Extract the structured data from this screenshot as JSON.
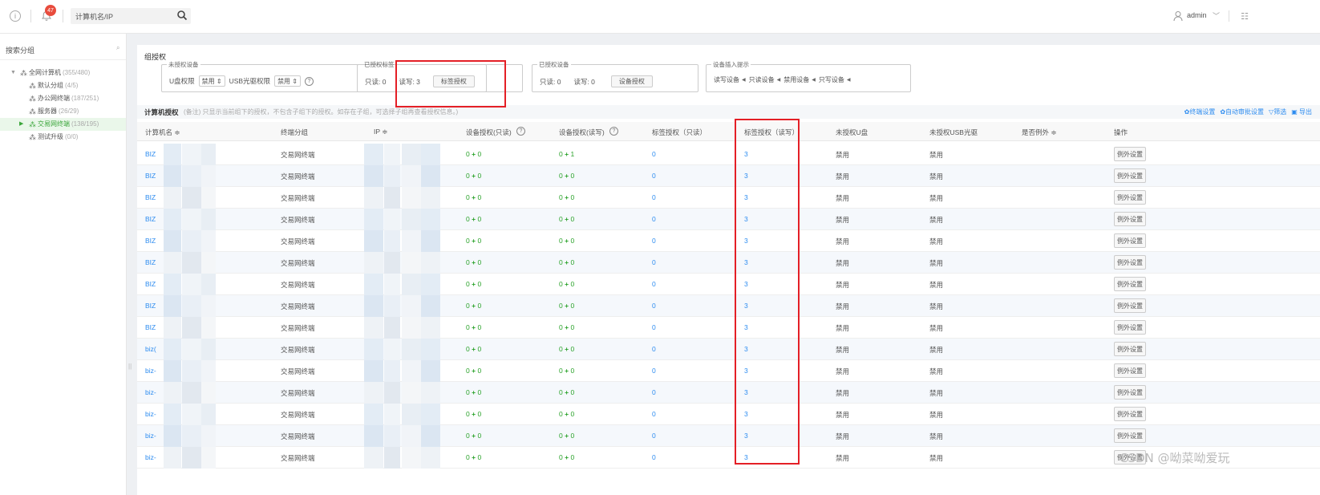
{
  "topbar": {
    "bell_badge": "47",
    "search_placeholder": "计算机名/IP",
    "user_name": "admin",
    "info_icon": "info-icon",
    "bell_icon": "bell-icon",
    "search_icon": "search-icon",
    "user_icon": "user-icon",
    "menu_icon": "menu-list-icon"
  },
  "sidebar": {
    "title": "搜索分组",
    "items": [
      {
        "label": "全网计算机",
        "count": "(355/480)",
        "arrow": "▼"
      },
      {
        "label": "默认分组",
        "count": "(4/5)",
        "arrow": ""
      },
      {
        "label": "办公网终端",
        "count": "(187/251)",
        "arrow": ""
      },
      {
        "label": "服务器",
        "count": "(26/29)",
        "arrow": ""
      },
      {
        "label": "交易网终端",
        "count": "(138/195)",
        "arrow": "▶"
      },
      {
        "label": "测试升级",
        "count": "(0/0)",
        "arrow": ""
      }
    ]
  },
  "group_auth": {
    "title": "组授权",
    "unauth_legend": "未授权设备",
    "u_disk_label": "U盘权限",
    "u_disk_value": "禁用",
    "usb_cd_label": "USB光驱权限",
    "usb_cd_value": "禁用",
    "tag_legend": "已授权标签",
    "tag_readonly": "只读: 0",
    "tag_readwrite": "读写: 3",
    "tag_button": "标签授权",
    "dev_legend": "已授权设备",
    "dev_readonly": "只读: 0",
    "dev_readwrite": "读写: 0",
    "dev_button": "设备授权",
    "prompt_legend": "设备插入提示",
    "prompt_items": [
      "读写设备",
      "只读设备",
      "禁用设备",
      "只写设备"
    ]
  },
  "list": {
    "title": "计算机授权",
    "note": "(备注) 只显示当前组下的授权，不包含子组下的授权。如存在子组，可选择子组再查看授权信息。)",
    "actions": [
      "终端设置",
      "自动审批设置",
      "筛选",
      "导出"
    ]
  },
  "table": {
    "headers": [
      "计算机名 ≑",
      "终端分组",
      "IP ≑",
      "设备授权(只读)",
      "设备授权(读写)",
      "标签授权（只读）",
      "标签授权（读写）",
      "未授权U盘",
      "未授权USB光驱",
      "是否例外 ≑",
      "操作"
    ],
    "rows": [
      {
        "name": "BIZ",
        "group": "交易网终端",
        "dev_ro": "0",
        "dev_ro_add": "0",
        "dev_rw": "0",
        "dev_rw_add": "1",
        "tag_ro": "0",
        "tag_rw": "3",
        "udisk": "禁用",
        "usbcd": "禁用",
        "op": "例外设置"
      },
      {
        "name": "BIZ",
        "group": "交易网终端",
        "dev_ro": "0",
        "dev_ro_add": "0",
        "dev_rw": "0",
        "dev_rw_add": "0",
        "tag_ro": "0",
        "tag_rw": "3",
        "udisk": "禁用",
        "usbcd": "禁用",
        "op": "例外设置"
      },
      {
        "name": "BIZ",
        "group": "交易网终端",
        "dev_ro": "0",
        "dev_ro_add": "0",
        "dev_rw": "0",
        "dev_rw_add": "0",
        "tag_ro": "0",
        "tag_rw": "3",
        "udisk": "禁用",
        "usbcd": "禁用",
        "op": "例外设置"
      },
      {
        "name": "BIZ",
        "group": "交易网终端",
        "dev_ro": "0",
        "dev_ro_add": "0",
        "dev_rw": "0",
        "dev_rw_add": "0",
        "tag_ro": "0",
        "tag_rw": "3",
        "udisk": "禁用",
        "usbcd": "禁用",
        "op": "例外设置"
      },
      {
        "name": "BIZ",
        "group": "交易网终端",
        "dev_ro": "0",
        "dev_ro_add": "0",
        "dev_rw": "0",
        "dev_rw_add": "0",
        "tag_ro": "0",
        "tag_rw": "3",
        "udisk": "禁用",
        "usbcd": "禁用",
        "op": "例外设置"
      },
      {
        "name": "BIZ",
        "group": "交易网终端",
        "dev_ro": "0",
        "dev_ro_add": "0",
        "dev_rw": "0",
        "dev_rw_add": "0",
        "tag_ro": "0",
        "tag_rw": "3",
        "udisk": "禁用",
        "usbcd": "禁用",
        "op": "例外设置"
      },
      {
        "name": "BIZ",
        "group": "交易网终端",
        "dev_ro": "0",
        "dev_ro_add": "0",
        "dev_rw": "0",
        "dev_rw_add": "0",
        "tag_ro": "0",
        "tag_rw": "3",
        "udisk": "禁用",
        "usbcd": "禁用",
        "op": "例外设置"
      },
      {
        "name": "BIZ",
        "group": "交易网终端",
        "dev_ro": "0",
        "dev_ro_add": "0",
        "dev_rw": "0",
        "dev_rw_add": "0",
        "tag_ro": "0",
        "tag_rw": "3",
        "udisk": "禁用",
        "usbcd": "禁用",
        "op": "例外设置"
      },
      {
        "name": "BIZ",
        "group": "交易网终端",
        "dev_ro": "0",
        "dev_ro_add": "0",
        "dev_rw": "0",
        "dev_rw_add": "0",
        "tag_ro": "0",
        "tag_rw": "3",
        "udisk": "禁用",
        "usbcd": "禁用",
        "op": "例外设置"
      },
      {
        "name": "biz(",
        "group": "交易网终端",
        "dev_ro": "0",
        "dev_ro_add": "0",
        "dev_rw": "0",
        "dev_rw_add": "0",
        "tag_ro": "0",
        "tag_rw": "3",
        "udisk": "禁用",
        "usbcd": "禁用",
        "op": "例外设置"
      },
      {
        "name": "biz-",
        "group": "交易网终端",
        "dev_ro": "0",
        "dev_ro_add": "0",
        "dev_rw": "0",
        "dev_rw_add": "0",
        "tag_ro": "0",
        "tag_rw": "3",
        "udisk": "禁用",
        "usbcd": "禁用",
        "op": "例外设置"
      },
      {
        "name": "biz-",
        "group": "交易网终端",
        "dev_ro": "0",
        "dev_ro_add": "0",
        "dev_rw": "0",
        "dev_rw_add": "0",
        "tag_ro": "0",
        "tag_rw": "3",
        "udisk": "禁用",
        "usbcd": "禁用",
        "op": "例外设置"
      },
      {
        "name": "biz-",
        "group": "交易网终端",
        "dev_ro": "0",
        "dev_ro_add": "0",
        "dev_rw": "0",
        "dev_rw_add": "0",
        "tag_ro": "0",
        "tag_rw": "3",
        "udisk": "禁用",
        "usbcd": "禁用",
        "op": "例外设置"
      },
      {
        "name": "biz-",
        "group": "交易网终端",
        "dev_ro": "0",
        "dev_ro_add": "0",
        "dev_rw": "0",
        "dev_rw_add": "0",
        "tag_ro": "0",
        "tag_rw": "3",
        "udisk": "禁用",
        "usbcd": "禁用",
        "op": "例外设置"
      },
      {
        "name": "biz-",
        "group": "交易网终端",
        "dev_ro": "0",
        "dev_ro_add": "0",
        "dev_rw": "0",
        "dev_rw_add": "0",
        "tag_ro": "0",
        "tag_rw": "3",
        "udisk": "禁用",
        "usbcd": "禁用",
        "op": "例外设置"
      }
    ]
  },
  "watermark": "CSDN @呦菜呦爱玩",
  "colors": {
    "accent": "#2d8cf0",
    "green": "#2aa22a",
    "highlight": "#e41f26",
    "badge": "#e84c3d"
  }
}
